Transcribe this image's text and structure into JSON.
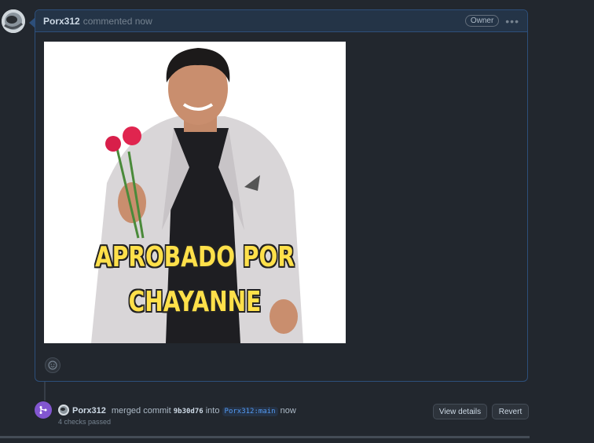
{
  "comment": {
    "author": "Porx312",
    "action": "commented now",
    "badge": "Owner",
    "meme_lines": [
      "APROBADO POR",
      "CHAYANNE"
    ]
  },
  "merge_event": {
    "author": "Porx312",
    "action": "merged commit",
    "commit_sha": "9b30d76",
    "into": "into",
    "branch": "Porx312:main",
    "time": "now",
    "checks": "4 checks passed"
  },
  "buttons": {
    "view_details": "View details",
    "revert": "Revert"
  },
  "icons": {
    "emoji": "smiley-icon",
    "merge": "git-merge-icon",
    "more": "kebab-icon"
  },
  "colors": {
    "merge_purple": "#8256d0",
    "meme_text": "#ffe04a"
  }
}
